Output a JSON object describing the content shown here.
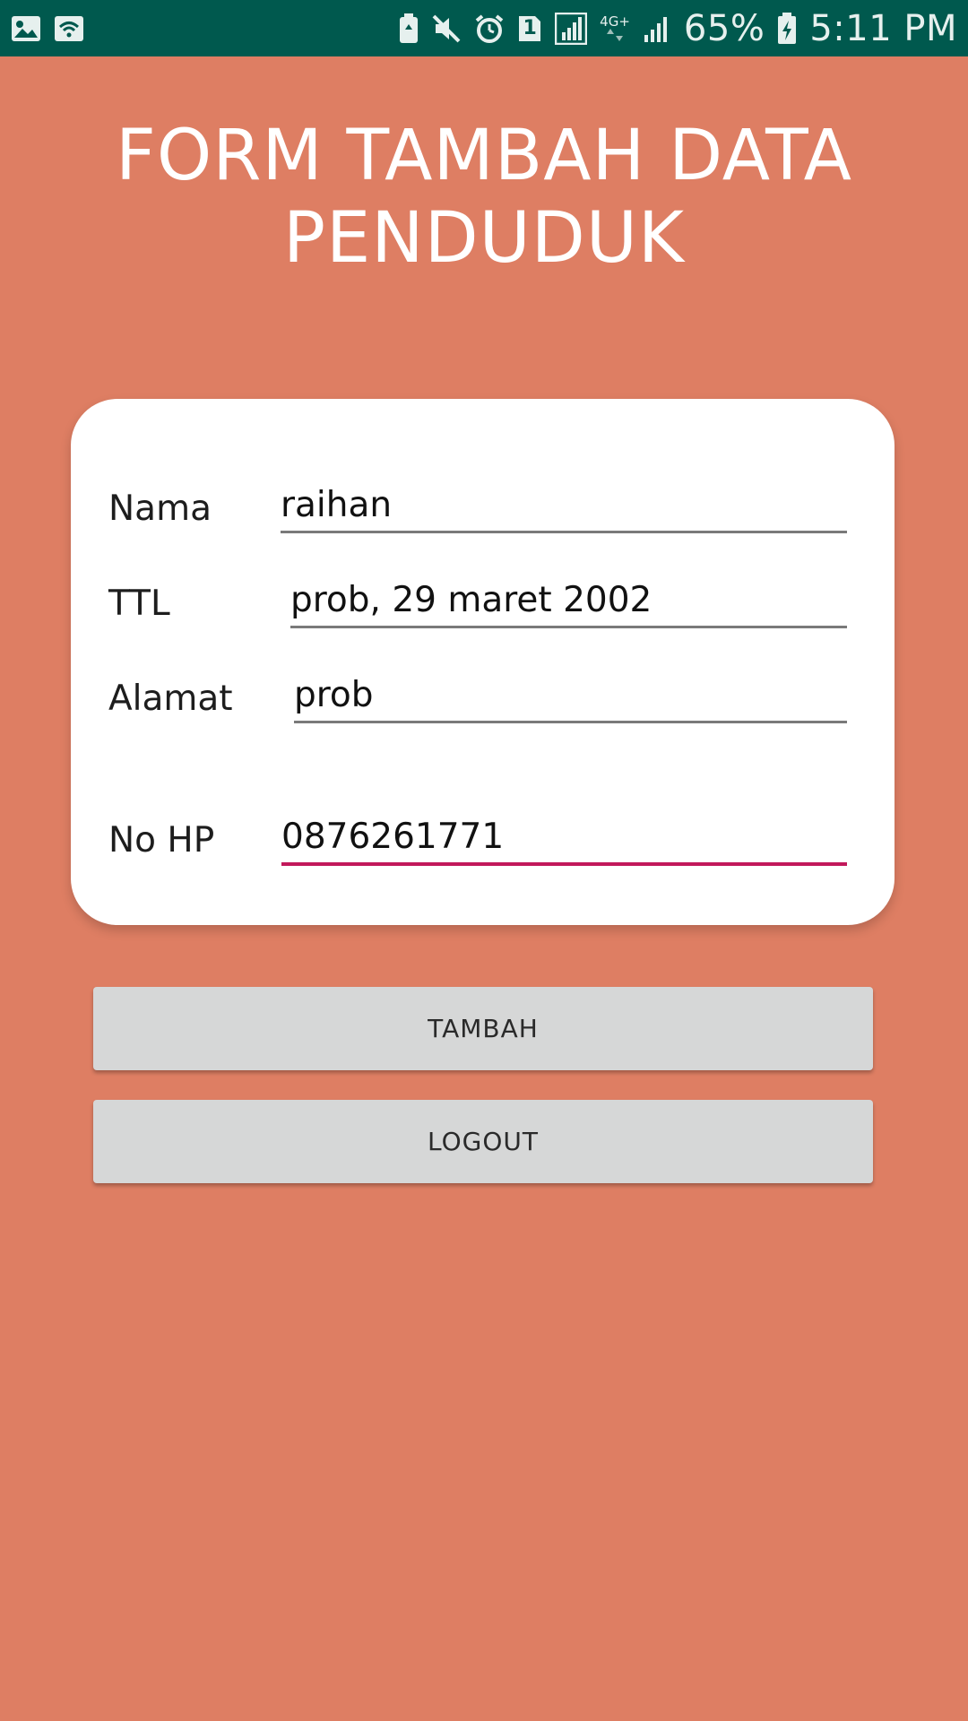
{
  "status_bar": {
    "battery_percent": "65%",
    "time": "5:11 PM",
    "network_label": "4G+",
    "sim_slot": "1",
    "left_icons": [
      "image-icon",
      "wifi-hotspot-icon"
    ],
    "right_icons": [
      "battery-saver-icon",
      "mute-icon",
      "alarm-icon",
      "sim-1-icon",
      "signal-icon",
      "network-4g-icon",
      "signal-icon-2",
      "battery-icon"
    ]
  },
  "title": {
    "line1": "FORM TAMBAH DATA",
    "line2": "PENDUDUK"
  },
  "form": {
    "nama": {
      "label": "Nama",
      "value": "raihan"
    },
    "ttl": {
      "label": "TTL",
      "value": "prob, 29 maret 2002"
    },
    "alamat": {
      "label": "Alamat",
      "value": "prob"
    },
    "no_hp": {
      "label": "No HP",
      "value": "0876261771"
    }
  },
  "buttons": {
    "tambah": "TAMBAH",
    "logout": "LOGOUT"
  },
  "colors": {
    "background": "#de7e63",
    "status_bar": "#00594e",
    "card": "#ffffff",
    "button": "#d6d7d7",
    "active_underline": "#c2185b"
  }
}
